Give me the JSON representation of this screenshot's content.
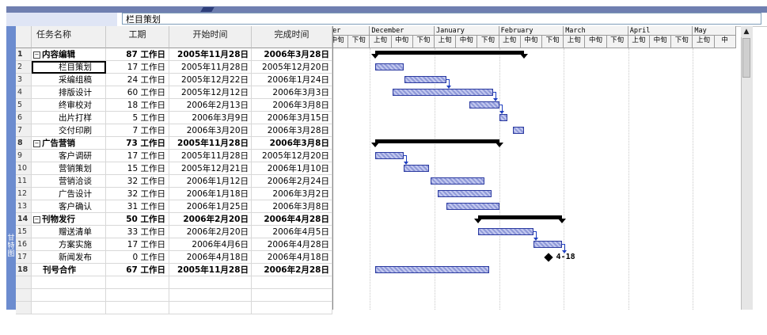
{
  "entry_bar": {
    "value": "栏目策划"
  },
  "view_bar": {
    "label": "甘特图"
  },
  "columns": {
    "name": "任务名称",
    "duration": "工期",
    "start": "开始时间",
    "finish": "完成时间"
  },
  "tasks": [
    {
      "id": "1",
      "name": "内容编辑",
      "duration": "87 工作日",
      "start": "2005年11月28日",
      "finish": "2006年3月28日",
      "summary": true
    },
    {
      "id": "2",
      "name": "栏目策划",
      "duration": "17 工作日",
      "start": "2005年11月28日",
      "finish": "2005年12月20日",
      "selected": true
    },
    {
      "id": "3",
      "name": "采编组稿",
      "duration": "24 工作日",
      "start": "2005年12月22日",
      "finish": "2006年1月24日"
    },
    {
      "id": "4",
      "name": "排版设计",
      "duration": "60 工作日",
      "start": "2005年12月12日",
      "finish": "2006年3月3日"
    },
    {
      "id": "5",
      "name": "终审校对",
      "duration": "18 工作日",
      "start": "2006年2月13日",
      "finish": "2006年3月8日"
    },
    {
      "id": "6",
      "name": "出片打样",
      "duration": "5 工作日",
      "start": "2006年3月9日",
      "finish": "2006年3月15日"
    },
    {
      "id": "7",
      "name": "交付印刷",
      "duration": "7 工作日",
      "start": "2006年3月20日",
      "finish": "2006年3月28日"
    },
    {
      "id": "8",
      "name": "广告营销",
      "duration": "73 工作日",
      "start": "2005年11月28日",
      "finish": "2006年3月8日",
      "summary": true
    },
    {
      "id": "9",
      "name": "客户调研",
      "duration": "17 工作日",
      "start": "2005年11月28日",
      "finish": "2005年12月20日"
    },
    {
      "id": "10",
      "name": "营销策划",
      "duration": "15 工作日",
      "start": "2005年12月21日",
      "finish": "2006年1月10日"
    },
    {
      "id": "11",
      "name": "营销洽谈",
      "duration": "32 工作日",
      "start": "2006年1月12日",
      "finish": "2006年2月24日"
    },
    {
      "id": "12",
      "name": "广告设计",
      "duration": "32 工作日",
      "start": "2006年1月18日",
      "finish": "2006年3月2日"
    },
    {
      "id": "13",
      "name": "客户确认",
      "duration": "31 工作日",
      "start": "2006年1月25日",
      "finish": "2006年3月8日"
    },
    {
      "id": "14",
      "name": "刊物发行",
      "duration": "50 工作日",
      "start": "2006年2月20日",
      "finish": "2006年4月28日",
      "summary": true
    },
    {
      "id": "15",
      "name": "赠送清单",
      "duration": "33 工作日",
      "start": "2006年2月20日",
      "finish": "2006年4月5日"
    },
    {
      "id": "16",
      "name": "方案实施",
      "duration": "17 工作日",
      "start": "2006年4月6日",
      "finish": "2006年4月28日"
    },
    {
      "id": "17",
      "name": "新闻发布",
      "duration": "0 工作日",
      "start": "2006年4月18日",
      "finish": "2006年4月18日",
      "milestone_label": "4-18"
    },
    {
      "id": "18",
      "name": "刊号合作",
      "duration": "67 工作日",
      "start": "2005年11月28日",
      "finish": "2006年2月28日",
      "summary_bold": true
    }
  ],
  "timescale": {
    "months": [
      "ber",
      "December",
      "January",
      "February",
      "March",
      "April",
      "May"
    ],
    "ticks": [
      "中旬",
      "下旬",
      "上旬",
      "中旬",
      "下旬",
      "上旬",
      "中旬",
      "下旬",
      "上旬",
      "中旬",
      "下旬",
      "上旬",
      "中旬",
      "下旬",
      "上旬",
      "中旬",
      "下旬",
      "上旬",
      "中"
    ]
  },
  "colors": {
    "task_bar": "#8f99d8",
    "summary_bar": "#000000",
    "link": "#1f3fc0"
  }
}
